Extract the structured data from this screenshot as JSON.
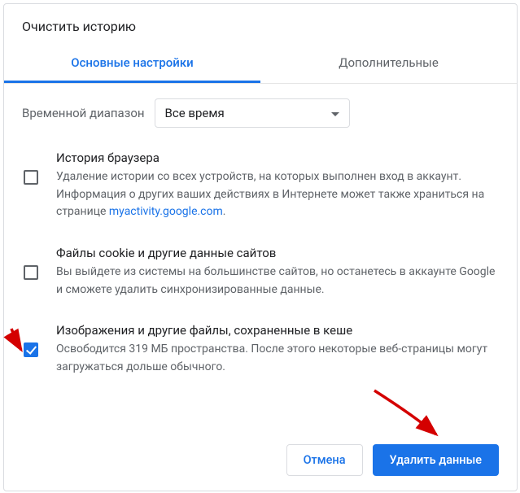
{
  "dialog": {
    "title": "Очистить историю"
  },
  "tabs": {
    "basic": "Основные настройки",
    "advanced": "Дополнительные"
  },
  "range": {
    "label": "Временной диапазон",
    "value": "Все время"
  },
  "options": {
    "history": {
      "title": "История браузера",
      "desc_before": "Удаление истории со всех устройств, на которых выполнен вход в аккаунт. Информация о других ваших действиях в Интернете может также храниться на странице ",
      "link": "myactivity.google.com",
      "desc_after": ".",
      "checked": false
    },
    "cookies": {
      "title": "Файлы cookie и другие данные сайтов",
      "desc": "Вы выйдете из системы на большинстве сайтов, но останетесь в аккаунте Google и сможете удалить синхронизированные данные.",
      "checked": false
    },
    "cache": {
      "title": "Изображения и другие файлы, сохраненные в кеше",
      "desc": "Освободится 319 МБ пространства. После этого некоторые веб-страницы могут загружаться дольше обычного.",
      "checked": true
    }
  },
  "buttons": {
    "cancel": "Отмена",
    "confirm": "Удалить данные"
  }
}
